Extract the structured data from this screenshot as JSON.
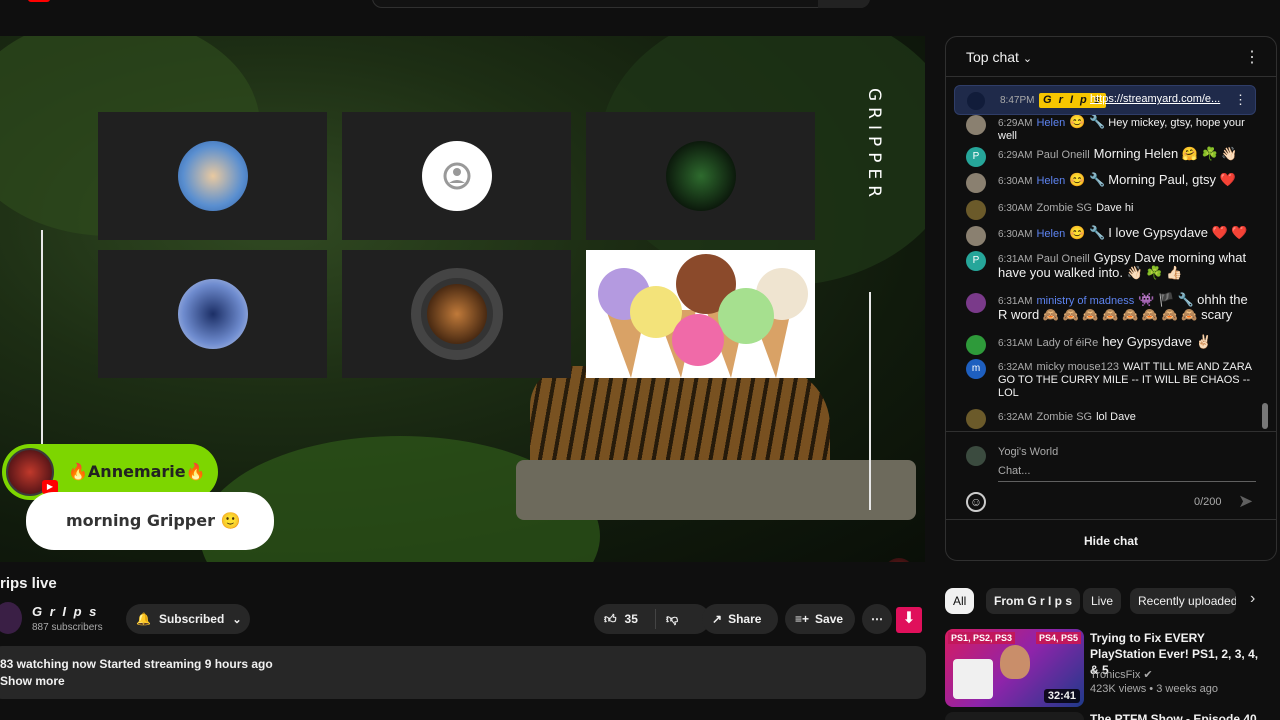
{
  "video": {
    "overlay_text": "GRIPPER",
    "name_tag": "🔥Annemarie🔥",
    "chat_bubble": "morning Gripper 🙂"
  },
  "title": "rips live",
  "channel": {
    "name": "G r I p s",
    "subscribers": "887 subscribers",
    "subscribe_label": "Subscribed"
  },
  "actions": {
    "likes": "35",
    "share": "Share",
    "save": "Save"
  },
  "description": {
    "line1": "83 watching now  Started streaming 9 hours ago",
    "line2": "Show more"
  },
  "chat": {
    "title": "Top chat",
    "pinned": {
      "time": "8:47PM",
      "author": "G r I p s",
      "link": "https://streamyard.com/e..."
    },
    "messages": [
      {
        "time": "6:29AM",
        "author": "Helen",
        "badges": "😊 🔧",
        "text": "Hey mickey, gtsy, hope your well",
        "mod": true,
        "avatar": ""
      },
      {
        "time": "6:29AM",
        "author": "Paul Oneill",
        "badges": "",
        "text": "Morning Helen 🤗 ☘️ 👋🏻",
        "mod": false,
        "avatar": "P"
      },
      {
        "time": "6:30AM",
        "author": "Helen",
        "badges": "😊 🔧",
        "text": "Morning Paul, gtsy ❤️",
        "mod": true,
        "avatar": ""
      },
      {
        "time": "6:30AM",
        "author": "Zombie SG",
        "badges": "",
        "text": "Dave hi",
        "mod": false,
        "avatar": ""
      },
      {
        "time": "6:30AM",
        "author": "Helen",
        "badges": "😊 🔧",
        "text": "I love Gypsydave ❤️ ❤️",
        "mod": true,
        "avatar": ""
      },
      {
        "time": "6:31AM",
        "author": "Paul Oneill",
        "badges": "",
        "text": "Gypsy Dave morning what have you walked into. 👋🏻 ☘️ 👍🏻",
        "mod": false,
        "avatar": "P"
      },
      {
        "time": "6:31AM",
        "author": "ministry of madness",
        "badges": "👾 🏴 🔧",
        "text": "ohhh the R word 🙈 🙈 🙈 🙈 🙈 🙈 🙈 🙈 scary",
        "mod": true,
        "avatar": ""
      },
      {
        "time": "6:31AM",
        "author": "Lady of éiRe",
        "badges": "",
        "text": "hey Gypsydave ✌🏻",
        "mod": false,
        "avatar": ""
      },
      {
        "time": "6:32AM",
        "author": "micky mouse123",
        "badges": "",
        "text": "WAIT TILL ME AND ZARA GO TO THE CURRY MILE -- IT WILL BE CHAOS -- LOL",
        "mod": false,
        "avatar": "m"
      },
      {
        "time": "6:32AM",
        "author": "Zombie SG",
        "badges": "",
        "text": "lol Dave",
        "mod": false,
        "avatar": ""
      }
    ],
    "input_user": "Yogi's World",
    "input_placeholder": "Chat...",
    "counter": "0/200",
    "hide_label": "Hide chat"
  },
  "chips": [
    "All",
    "From G r I p s",
    "Live",
    "Recently uploaded"
  ],
  "recommendation": {
    "title": "Trying to Fix EVERY PlayStation Ever! PS1, 2, 3, 4, & 5",
    "channel": "TronicsFix",
    "meta": "423K views • 3 weeks ago",
    "duration": "32:41",
    "tag_left": "PS1, PS2, PS3",
    "tag_right": "PS4, PS5"
  },
  "recommendation2": {
    "title": "The PTFM Show - Episode 40"
  },
  "colors": {
    "accent": "#f7c600",
    "mod_name": "#5e84f1",
    "subscribe_bg": "#272727",
    "download": "#e0105b"
  }
}
